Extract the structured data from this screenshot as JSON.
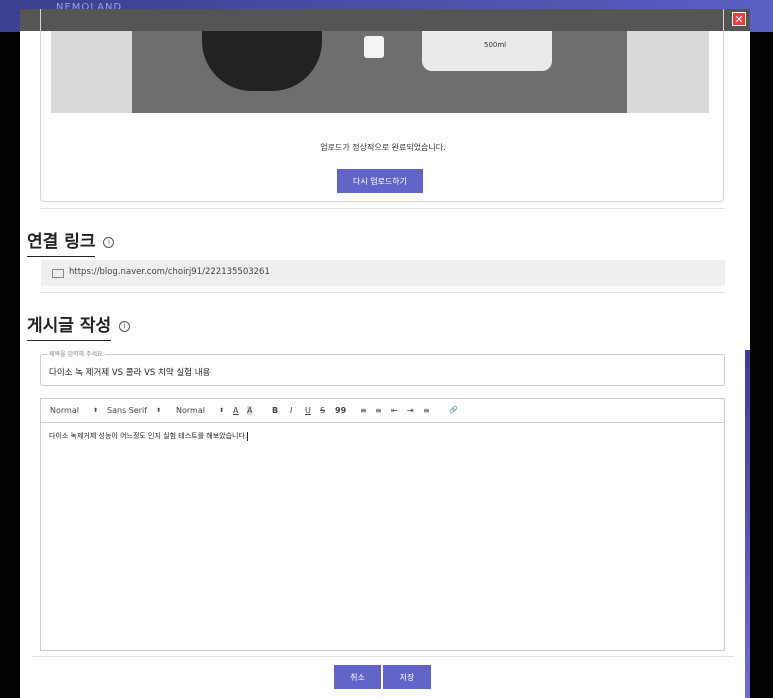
{
  "topbar": {
    "brand": "NEMOLAND"
  },
  "modal": {
    "close_symbol": "✕"
  },
  "upload": {
    "bottle_label": "500ml",
    "message": "업로드가 정상적으로 완료되었습니다.",
    "reupload_label": "다시 업로드하기"
  },
  "link_section": {
    "title": "연결 링크",
    "info_symbol": "i",
    "url": "https://blog.naver.com/choirj91/222135503261"
  },
  "post_section": {
    "title": "게시글 작성",
    "info_symbol": "i",
    "title_placeholder": "제목을 입력해 주세요",
    "title_value": "다이소 녹 제거제 VS 콜라 VS 치약  실험 내용"
  },
  "editor": {
    "heading_select": "Normal",
    "font_select": "Sans Serif",
    "size_select": "Normal",
    "arrow": "⬍",
    "toolbar_icons": [
      "A",
      "A",
      "B",
      "I",
      "U",
      "S",
      "99",
      "≡",
      "≡",
      "⇤",
      "⇥",
      "≡",
      "🔗"
    ],
    "body_text": "다이소 녹제거제 성능이 어느정도 인지 실험 테스트를 해보았습니다."
  },
  "footer": {
    "cancel_label": "취소",
    "save_label": "저장"
  }
}
